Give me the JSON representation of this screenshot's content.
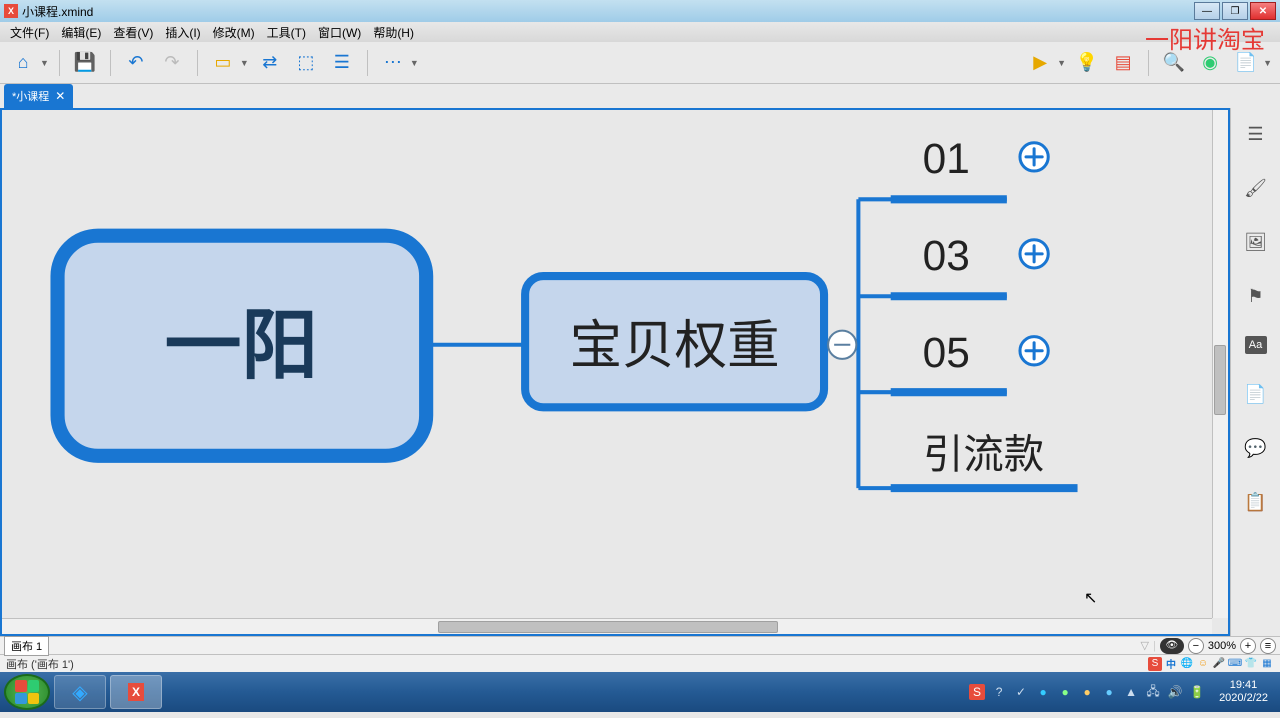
{
  "title": "小课程.xmind",
  "watermark": "一阳讲淘宝",
  "menus": [
    "文件(F)",
    "编辑(E)",
    "查看(V)",
    "插入(I)",
    "修改(M)",
    "工具(T)",
    "窗口(W)",
    "帮助(H)"
  ],
  "tab": {
    "name": "*小课程",
    "close": "✕"
  },
  "nodes": {
    "root": "一阳",
    "child1": "宝贝权重",
    "leaves": [
      "01",
      "03",
      "05",
      "引流款"
    ]
  },
  "sheet": "画布 1",
  "status": "画布 ('画布 1')",
  "zoom": "300%",
  "clock": {
    "time": "19:41",
    "date": "2020/2/22"
  },
  "tray_ime": "中"
}
